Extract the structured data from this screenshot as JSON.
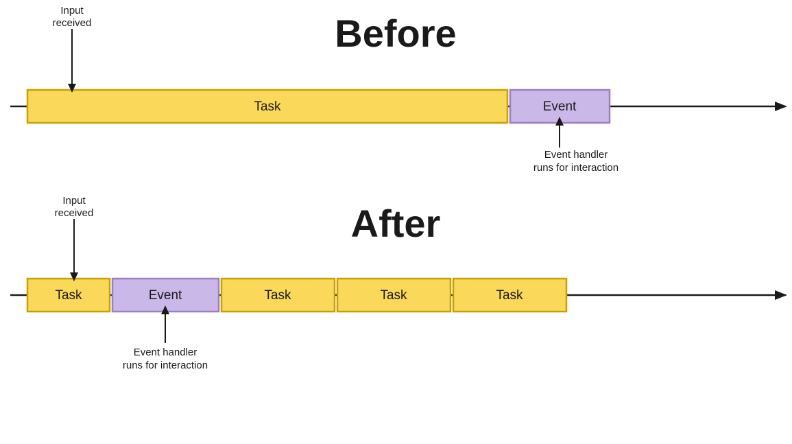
{
  "before": {
    "title": "Before",
    "task_label": "Task",
    "event_label": "Event",
    "input_received": "Input\nreceived",
    "event_handler": "Event handler\nruns for interaction"
  },
  "after": {
    "title": "After",
    "task_label": "Task",
    "event_label": "Event",
    "task2_label": "Task",
    "task3_label": "Task",
    "task4_label": "Task",
    "input_received": "Input\nreceived",
    "event_handler": "Event handler\nruns for interaction"
  }
}
